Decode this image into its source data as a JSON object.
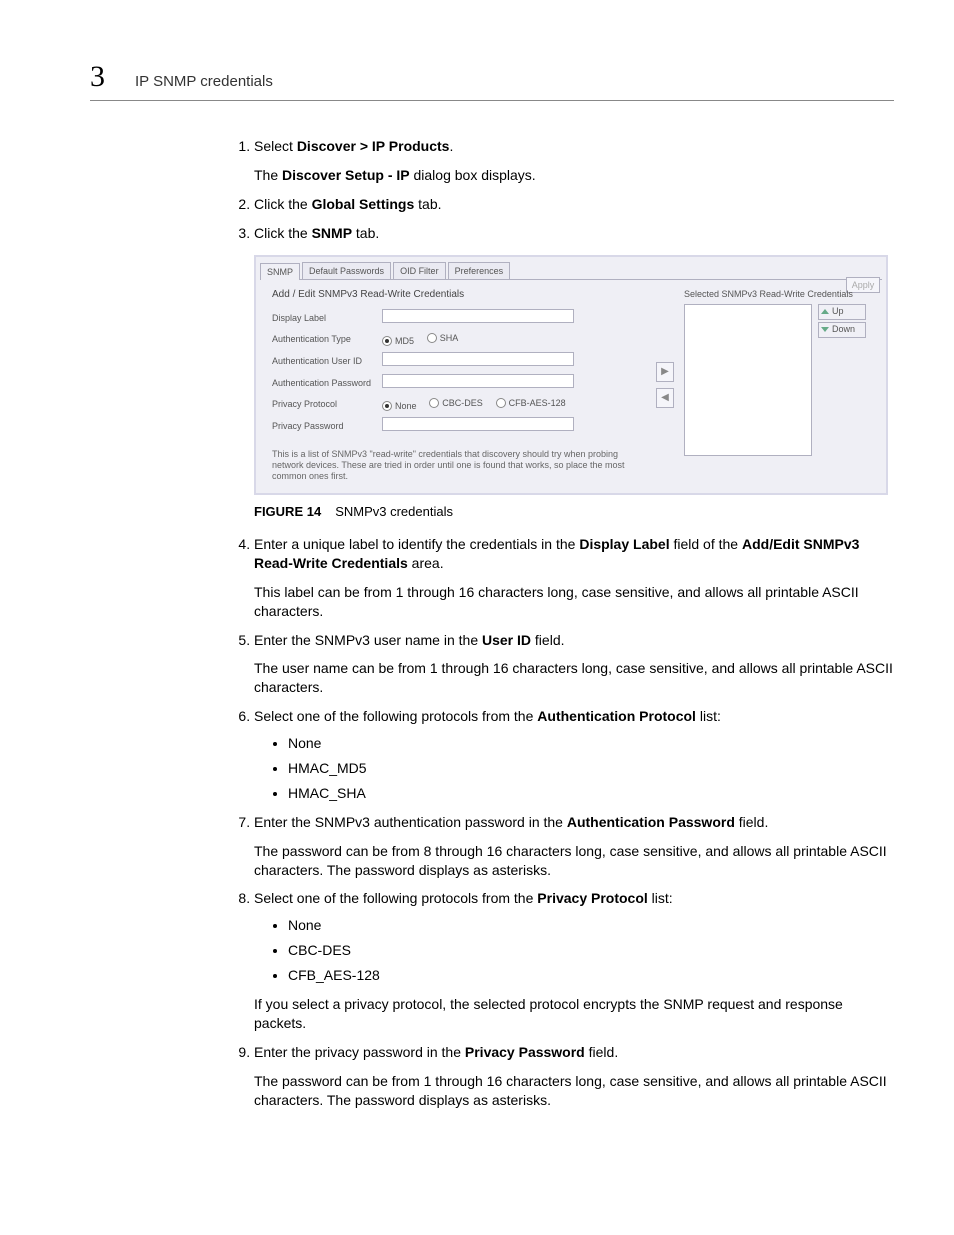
{
  "header": {
    "chapter_number": "3",
    "chapter_title": "IP SNMP credentials"
  },
  "steps": {
    "s1": {
      "pre": "Select ",
      "bold": "Discover > IP Products",
      "post": ".",
      "para_pre": "The ",
      "para_bold": "Discover Setup - IP",
      "para_post": " dialog box displays."
    },
    "s2": {
      "pre": "Click the ",
      "bold": "Global Settings",
      "post": " tab."
    },
    "s3": {
      "pre": "Click the ",
      "bold": "SNMP",
      "post": " tab."
    },
    "s4": {
      "pre": "Enter a unique label to identify the credentials in the ",
      "bold1": "Display Label",
      "mid": " field of the ",
      "bold2": "Add/Edit SNMPv3 Read-Write Credentials",
      "post": " area.",
      "para": "This label can be from 1 through 16 characters long, case sensitive, and allows all printable ASCII characters."
    },
    "s5": {
      "pre": "Enter the SNMPv3 user name in the ",
      "bold": "User ID",
      "post": " field.",
      "para": "The user name can be from 1 through 16 characters long, case sensitive, and allows all printable ASCII characters."
    },
    "s6": {
      "pre": "Select one of the following protocols from the ",
      "bold": "Authentication Protocol",
      "post": " list:",
      "bullets": [
        "None",
        "HMAC_MD5",
        "HMAC_SHA"
      ]
    },
    "s7": {
      "pre": "Enter the SNMPv3 authentication password in the ",
      "bold": "Authentication Password",
      "post": " field.",
      "para": "The password can be from 8 through 16 characters long, case sensitive, and allows all printable ASCII characters. The password displays as asterisks."
    },
    "s8": {
      "pre": "Select one of the following protocols from the ",
      "bold": "Privacy Protocol",
      "post": " list:",
      "bullets": [
        "None",
        "CBC-DES",
        "CFB_AES-128"
      ],
      "para": "If you select a privacy protocol, the selected protocol encrypts the SNMP request and response packets."
    },
    "s9": {
      "pre": "Enter the privacy password in the ",
      "bold": "Privacy Password",
      "post": " field.",
      "para": "The password can be from 1 through 16 characters long, case sensitive, and allows all printable ASCII characters. The password displays as asterisks."
    }
  },
  "figure": {
    "label": "FIGURE 14",
    "caption": "SNMPv3 credentials"
  },
  "screenshot": {
    "tabs": [
      "SNMP",
      "Default Passwords",
      "OID Filter",
      "Preferences"
    ],
    "active_tab": "SNMP",
    "apply": "Apply",
    "left_title": "Add / Edit SNMPv3 Read-Write Credentials",
    "fields": {
      "display_label": "Display Label",
      "auth_type": "Authentication Type",
      "auth_user": "Authentication User ID",
      "auth_pw": "Authentication Password",
      "priv_proto": "Privacy Protocol",
      "priv_pw": "Privacy Password"
    },
    "auth_radios": {
      "md5": "MD5",
      "sha": "SHA"
    },
    "priv_radios": {
      "none": "None",
      "cbcdes": "CBC-DES",
      "cfb": "CFB-AES-128"
    },
    "note": "This is a list of SNMPv3 \"read-write\" credentials that discovery should try when probing network devices. These are tried in order until one is found that works, so place the most common ones first.",
    "right_title": "Selected SNMPv3 Read-Write Credentials",
    "up": "Up",
    "down": "Down",
    "arrow_right": "▶",
    "arrow_left": "◀"
  }
}
